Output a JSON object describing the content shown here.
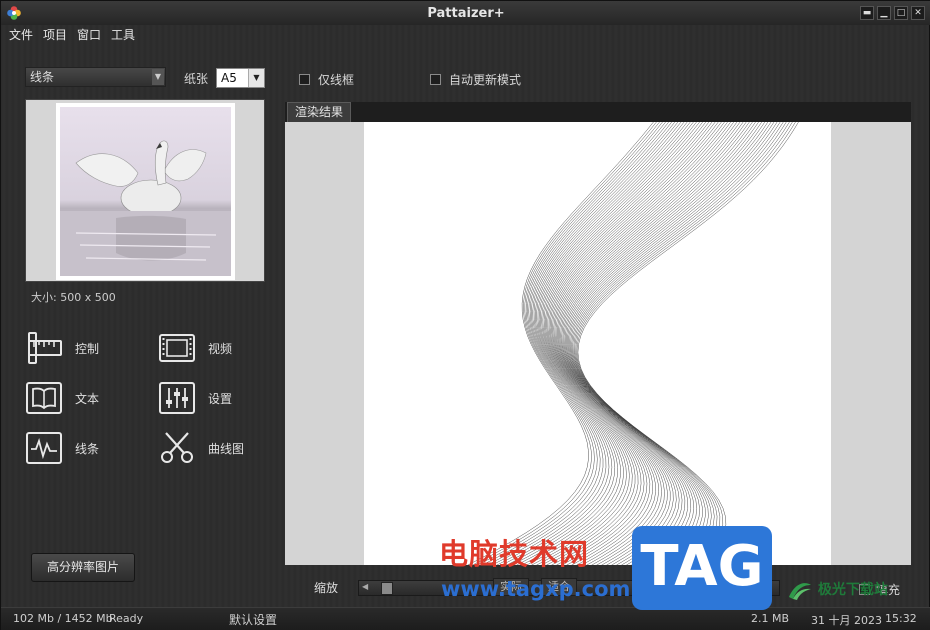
{
  "window": {
    "title": "Pattaizer+",
    "controls": [
      "▬",
      "▁",
      "□",
      "✕"
    ]
  },
  "menu": {
    "items": [
      "文件",
      "项目",
      "窗口",
      "工具"
    ]
  },
  "toolbar": {
    "mode_select": "线条",
    "paper_label": "纸张",
    "paper_value": "A5",
    "wireframe_only": "仅线框",
    "auto_update": "自动更新模式"
  },
  "preview": {
    "size_text": "大小: 500 x 500"
  },
  "tools": {
    "control": "控制",
    "video": "视频",
    "text": "文本",
    "settings": "设置",
    "lines": "线条",
    "curves": "曲线图"
  },
  "hires_button": "高分辨率图片",
  "render": {
    "tab_label": "渲染结果"
  },
  "zoom": {
    "label": "缩放",
    "btn_actual": "实际",
    "btn_fit": "适合",
    "fill_label": "填充"
  },
  "status": {
    "memory": "102 Mb / 1452 Mb",
    "state": "Ready",
    "preset": "默认设置",
    "file_size": "2.1 MB",
    "date": "31 十月 2023",
    "time": "15:32"
  },
  "watermark": {
    "site_name": "电脑技术网",
    "url": "www.tagxp.com",
    "badge": "TAG",
    "logo_text": "极光下载站"
  }
}
